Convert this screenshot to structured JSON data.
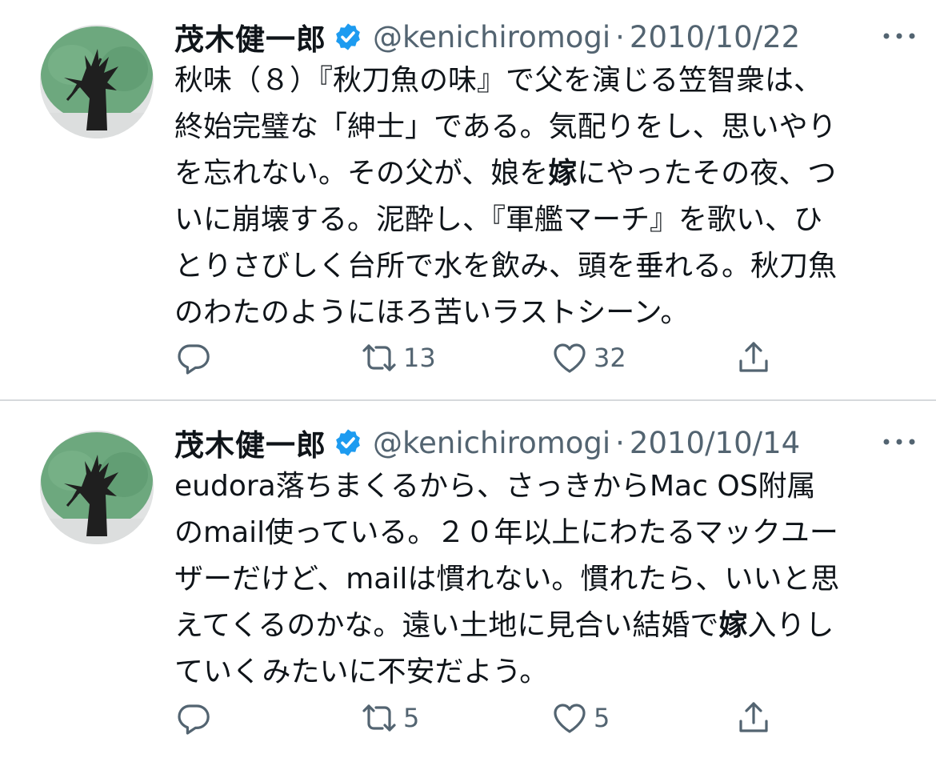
{
  "tweets": [
    {
      "author_name": "茂木健一郎",
      "handle": "@kenichiromogi",
      "separator": "·",
      "date": "2010/10/22",
      "lines": [
        [
          "秋味（８）『秋刀魚の味』で父を演じる笠智衆は、"
        ],
        [
          "終始完璧な「紳士」である。気配りをし、思いやり"
        ],
        [
          "を忘れない。その父が、娘を",
          "嫁",
          "にやったその夜、つ"
        ],
        [
          "いに崩壊する。泥酔し、『軍艦マーチ』を歌い、ひ"
        ],
        [
          "とりさびしく台所で水を飲み、頭を垂れる。秋刀魚"
        ],
        [
          "のわたのようにほろ苦いラストシーン。"
        ]
      ],
      "retweets": "13",
      "likes": "32"
    },
    {
      "author_name": "茂木健一郎",
      "handle": "@kenichiromogi",
      "separator": "·",
      "date": "2010/10/14",
      "lines": [
        [
          "eudora落ちまくるから、さっきからMac OS附属"
        ],
        [
          "のmail使っている。２０年以上にわたるマックユー"
        ],
        [
          "ザーだけど、mailは慣れない。慣れたら、いいと思"
        ],
        [
          "えてくるのかな。遠い土地に見合い結婚で",
          "嫁",
          "入りし"
        ],
        [
          "ていくみたいに不安だよう。"
        ]
      ],
      "retweets": "5",
      "likes": "5"
    }
  ],
  "icons": {
    "verified": "verified-badge-icon",
    "more": "more-icon",
    "reply": "reply-icon",
    "retweet": "retweet-icon",
    "like": "heart-icon",
    "share": "share-icon"
  },
  "colors": {
    "text": "#0f1419",
    "secondary": "#536471",
    "verified": "#1d9bf0",
    "divider": "#d6d9dc"
  }
}
